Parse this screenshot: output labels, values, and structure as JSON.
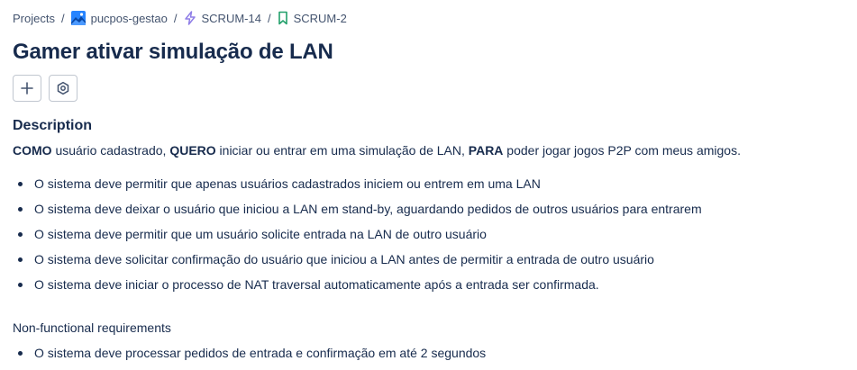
{
  "breadcrumb": {
    "projects": "Projects",
    "project": "pucpos-gestao",
    "epic": "SCRUM-14",
    "issue": "SCRUM-2",
    "separator": "/"
  },
  "issue": {
    "title": "Gamer ativar simulação de LAN"
  },
  "actions": [
    {
      "icon": "plus-icon",
      "label": "Add"
    },
    {
      "icon": "apps-icon",
      "label": "Apps"
    }
  ],
  "description": {
    "heading": "Description",
    "story": {
      "as_kw": "COMO",
      "as_text": " usuário cadastrado, ",
      "want_kw": "QUERO",
      "want_text": " iniciar ou entrar em uma simulação de LAN, ",
      "so_kw": "PARA",
      "so_text": " poder jogar jogos P2P com meus amigos."
    },
    "requirements": [
      "O sistema deve permitir que apenas usuários cadastrados iniciem ou entrem em uma LAN",
      "O sistema deve deixar o usuário que iniciou a LAN em stand-by, aguardando pedidos de outros usuários para entrarem",
      "O sistema deve permitir que um usuário solicite entrada na LAN de outro usuário",
      "O sistema deve solicitar confirmação do usuário que iniciou a LAN antes de permitir a entrada de outro usuário",
      "O sistema deve iniciar o processo de NAT traversal automaticamente após a entrada ser confirmada."
    ],
    "nfr_heading": "Non-functional requirements",
    "nfr": [
      "O sistema deve processar pedidos de entrada e confirmação em até 2 segundos"
    ]
  },
  "colors": {
    "text": "#172b4d",
    "subtle_text": "#44546f",
    "epic_purple": "#8f7ee7",
    "story_green": "#22a06b",
    "project_avatar_blue": "#2684ff"
  }
}
